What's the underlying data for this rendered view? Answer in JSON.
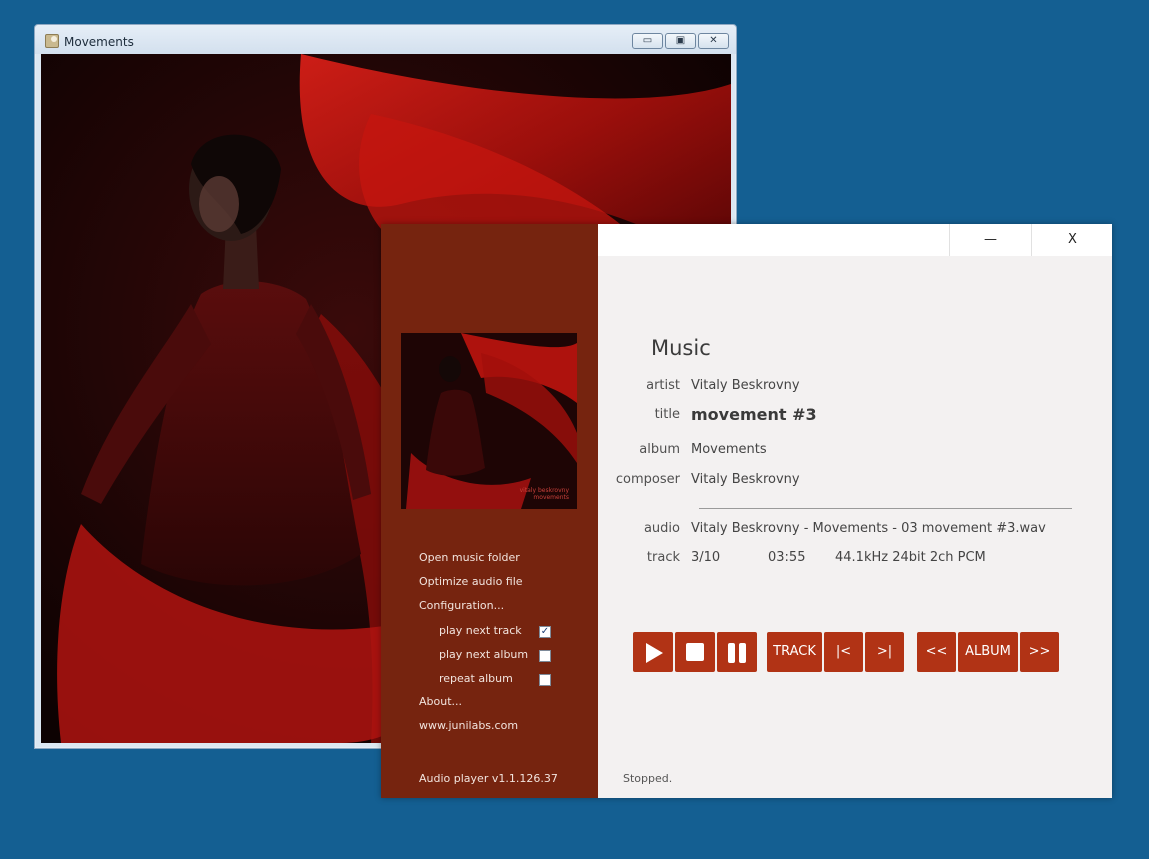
{
  "viewer": {
    "title": "Movements",
    "minimize": "▭",
    "maximize": "▣",
    "close": "✕"
  },
  "player": {
    "titlebar": {
      "minimize": "—",
      "close": "X"
    },
    "cover": {
      "caption_line1": "vitaly beskrovny",
      "caption_line2": "movements"
    },
    "menu": {
      "open_folder": "Open music folder",
      "optimize": "Optimize audio file",
      "configuration": "Configuration...",
      "options": [
        {
          "label": "play next track",
          "checked": true
        },
        {
          "label": "play next album",
          "checked": false
        },
        {
          "label": "repeat album",
          "checked": false
        }
      ],
      "about": "About...",
      "website": "www.junilabs.com"
    },
    "version": "Audio player v1.1.126.37",
    "section_title": "Music",
    "fields": {
      "artist_label": "artist",
      "artist": "Vitaly Beskrovny",
      "title_label": "title",
      "title": "movement #3",
      "album_label": "album",
      "album": "Movements",
      "composer_label": "composer",
      "composer": "Vitaly Beskrovny",
      "audio_label": "audio",
      "audio": "Vitaly Beskrovny - Movements - 03 movement #3.wav",
      "track_label": "track",
      "track": "3/10",
      "duration": "03:55",
      "format": "44.1kHz 24bit 2ch PCM"
    },
    "controls": {
      "track": "TRACK",
      "prev_track": "|<",
      "next_track": ">|",
      "prev_album": "<<",
      "album": "ALBUM",
      "next_album": ">>"
    },
    "status": "Stopped.",
    "accent_color": "#b13315",
    "sidebar_color": "#76240f"
  }
}
